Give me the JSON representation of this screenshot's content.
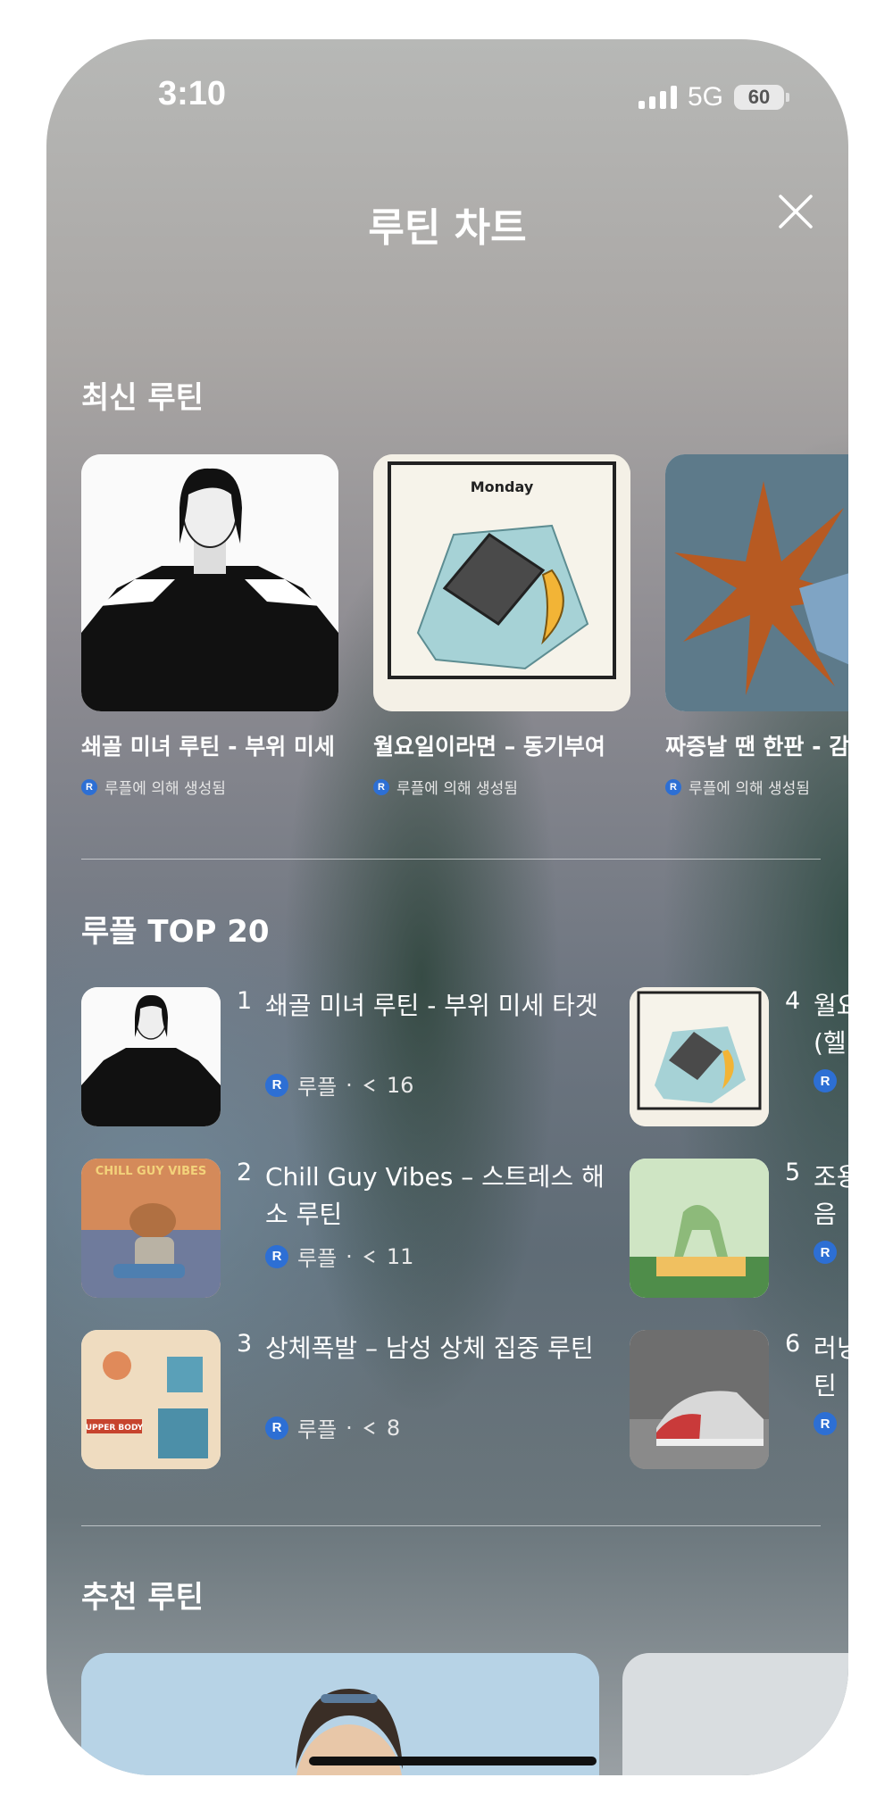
{
  "status": {
    "time": "3:10",
    "network": "5G",
    "battery": "60"
  },
  "header": {
    "title": "루틴 차트"
  },
  "latest": {
    "title": "최신 루틴",
    "items": [
      {
        "title": "쇄골 미녀 루틴 - 부위 미세",
        "sub": "루플에 의해 생성됨"
      },
      {
        "title": "월요일이라면 – 동기부여",
        "sub": "루플에 의해 생성됨",
        "image_label": "Monday"
      },
      {
        "title": "짜증날 땐 한판 - 감",
        "sub": "루플에 의해 생성됨"
      }
    ]
  },
  "top20": {
    "title": "루플 TOP 20",
    "items": [
      {
        "rank": "1",
        "title": "쇄골 미녀 루틴 - 부위 미세 타겟",
        "author": "루플",
        "shares": "16"
      },
      {
        "rank": "2",
        "title": "Chill Guy Vibes – 스트레스 해소 루틴",
        "author": "루플",
        "shares": "11",
        "image_label": "CHILL GUY VIBES"
      },
      {
        "rank": "3",
        "title": "상체폭발 – 남성 상체 집중 루틴",
        "author": "루플",
        "shares": "8",
        "image_label": "UPPER BODY"
      },
      {
        "rank": "4",
        "title": "월요",
        "title2": "(헬"
      },
      {
        "rank": "5",
        "title": "조용",
        "title2": "음"
      },
      {
        "rank": "6",
        "title": "러닝",
        "title2": "틴"
      }
    ]
  },
  "recommended": {
    "title": "추천 루틴"
  },
  "icons": {
    "close": "close-icon",
    "share": "share-icon",
    "creator": "ruple-logo-icon"
  }
}
